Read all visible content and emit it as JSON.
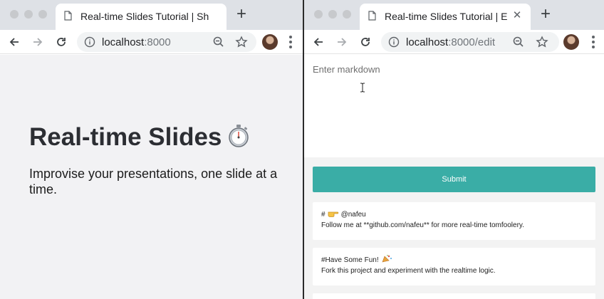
{
  "left_window": {
    "tab": {
      "title": "Real-time Slides Tutorial | Show"
    },
    "address": {
      "host": "localhost",
      "port": ":8000"
    },
    "slide": {
      "title": "Real-time Slides",
      "emoji_icon": "stopwatch-icon",
      "subtitle": "Improvise your presentations, one slide at a time."
    }
  },
  "right_window": {
    "tab": {
      "title": "Real-time Slides Tutorial | Edit"
    },
    "address": {
      "host": "localhost",
      "port": ":8000/edit"
    },
    "editor": {
      "placeholder": "Enter markdown",
      "submit_label": "Submit"
    },
    "slides": [
      {
        "heading_prefix": "#",
        "heading_icon": "pointing-hand-icon",
        "heading_text": "@nafeu",
        "body": "Follow me at **github.com/nafeu** for more real-time tomfoolery."
      },
      {
        "heading_prefix": "#Have Some Fun!",
        "heading_icon": "party-popper-icon",
        "heading_text": "",
        "body": "Fork this project and experiment with the realtime logic."
      }
    ]
  },
  "colors": {
    "accent": "#3aada6",
    "tabstrip": "#dee1e6",
    "slide_background": "#f2f2f4",
    "editor_background": "#f3f3f3"
  }
}
